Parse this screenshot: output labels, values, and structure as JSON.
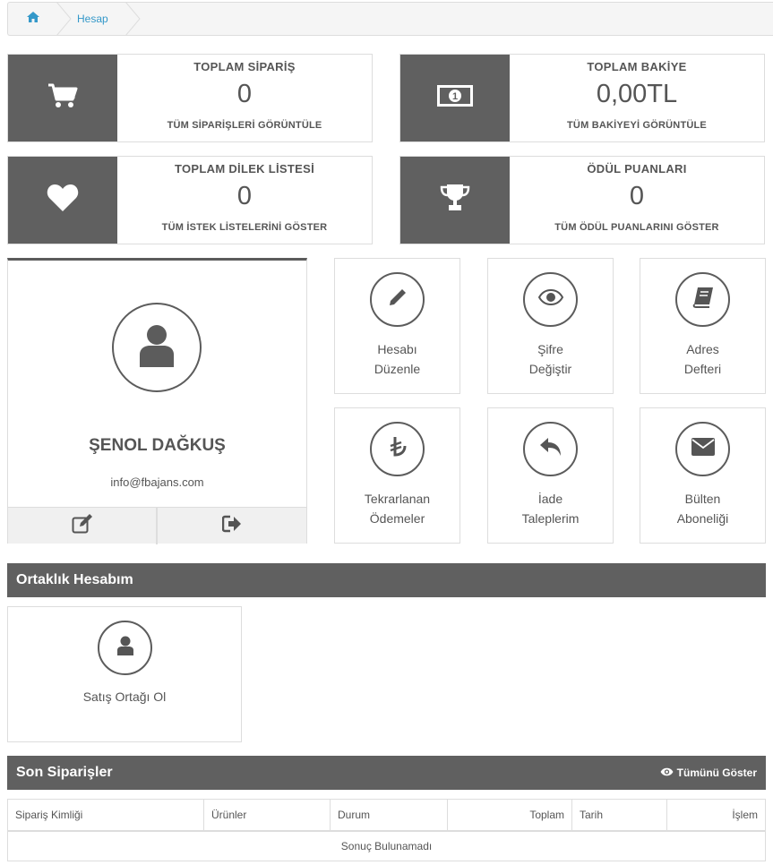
{
  "breadcrumb": {
    "home_icon": "home-icon",
    "current": "Hesap"
  },
  "stats": [
    {
      "title": "TOPLAM SİPARİŞ",
      "value": "0",
      "link": "TÜM SİPARİŞLERİ GÖRÜNTÜLE",
      "icon": "cart-icon"
    },
    {
      "title": "TOPLAM BAKİYE",
      "value": "0,00TL",
      "link": "TÜM BAKİYEYİ GÖRÜNTÜLE",
      "icon": "money-icon"
    },
    {
      "title": "TOPLAM DİLEK LİSTESİ",
      "value": "0",
      "link": "TÜM İSTEK LİSTELERİNİ GÖSTER",
      "icon": "heart-icon"
    },
    {
      "title": "ÖDÜL PUANLARI",
      "value": "0",
      "link": "TÜM ÖDÜL PUANLARINI GÖSTER",
      "icon": "trophy-icon"
    }
  ],
  "profile": {
    "name": "ŞENOL DAĞKUŞ",
    "email": "info@fbajans.com",
    "edit_icon": "edit-icon",
    "logout_icon": "logout-icon"
  },
  "tiles": [
    {
      "line1": "Hesabı",
      "line2": "Düzenle",
      "icon": "pencil-icon"
    },
    {
      "line1": "Şifre",
      "line2": "Değiştir",
      "icon": "eye-icon"
    },
    {
      "line1": "Adres",
      "line2": "Defteri",
      "icon": "book-icon"
    },
    {
      "line1": "Tekrarlanan",
      "line2": "Ödemeler",
      "icon": "lira-icon"
    },
    {
      "line1": "İade",
      "line2": "Taleplerim",
      "icon": "reply-icon"
    },
    {
      "line1": "Bülten",
      "line2": "Aboneliği",
      "icon": "envelope-icon"
    }
  ],
  "affiliate": {
    "heading": "Ortaklık Hesabım",
    "tile_label": "Satış Ortağı Ol",
    "icon": "user-icon"
  },
  "orders": {
    "heading": "Son Siparişler",
    "show_all": "Tümünü Göster",
    "columns": [
      "Sipariş Kimliği",
      "Ürünler",
      "Durum",
      "Toplam",
      "Tarih",
      "İşlem"
    ],
    "empty": "Sonuç Bulunamadı"
  },
  "colors": {
    "dark_gray": "#606060",
    "link_blue": "#3498c9",
    "border": "#dddddd"
  }
}
